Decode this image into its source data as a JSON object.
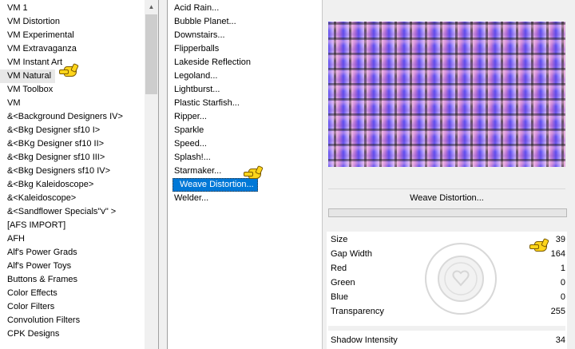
{
  "categories": {
    "items": [
      "VM 1",
      "VM Distortion",
      "VM Experimental",
      "VM Extravaganza",
      "VM Instant Art",
      "VM Natural",
      "VM Toolbox",
      "VM",
      "&<Background Designers IV>",
      "&<Bkg Designer sf10 I>",
      "&<BKg Designer sf10 II>",
      "&<Bkg Designer sf10 III>",
      "&<Bkg Designers sf10 IV>",
      "&<Bkg Kaleidoscope>",
      "&<Kaleidoscope>",
      "&<Sandflower Specials\"v\" >",
      "[AFS IMPORT]",
      "AFH",
      "Alf's Power Grads",
      "Alf's Power Toys",
      "Buttons & Frames",
      "Color Effects",
      "Color Filters",
      "Convolution Filters",
      "CPK Designs"
    ],
    "selected": "VM Natural"
  },
  "filters": {
    "items": [
      "Acid Rain...",
      "Bubble Planet...",
      "Downstairs...",
      "Flipperballs",
      "Lakeside Reflection",
      "Legoland...",
      "Lightburst...",
      "Plastic Starfish...",
      "Ripper...",
      "Sparkle",
      "Speed...",
      "Splash!...",
      "Starmaker...",
      "Weave Distortion...",
      "Welder..."
    ],
    "selected": "Weave Distortion..."
  },
  "filter_panel": {
    "title": "Weave Distortion...",
    "params": [
      {
        "name": "Size",
        "value": "39"
      },
      {
        "name": "Gap Width",
        "value": "164"
      },
      {
        "name": "Red",
        "value": "1"
      },
      {
        "name": "Green",
        "value": "0"
      },
      {
        "name": "Blue",
        "value": "0"
      },
      {
        "name": "Transparency",
        "value": "255"
      },
      {
        "name": "Shadow Intensity",
        "value": "34"
      }
    ]
  },
  "colors": {
    "selection": "#0078d7",
    "hand_pointer": "#ffd51a"
  },
  "icons": [
    "scroll-up-arrow-icon",
    "hand-pointer-icon"
  ]
}
